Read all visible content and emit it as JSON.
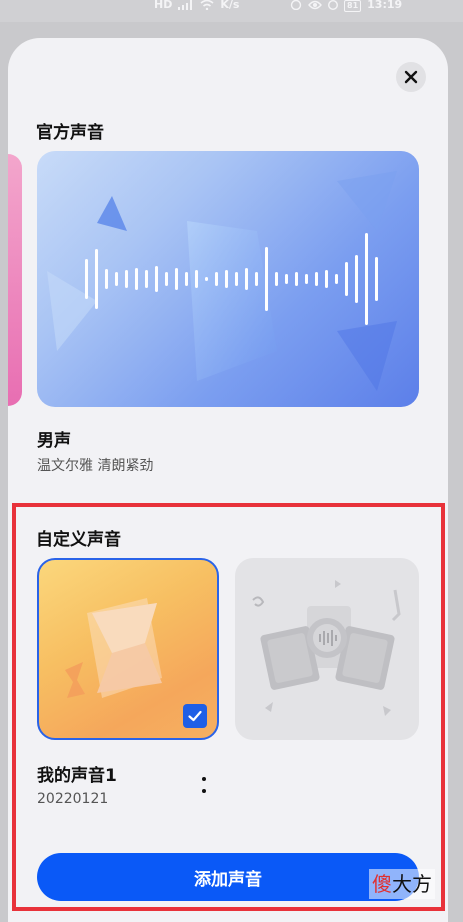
{
  "status_bar": {
    "left_icons": [
      "HD",
      "signal-icon",
      "wifi-icon",
      "K/s"
    ],
    "right_icons": [
      "nfc-icon",
      "eye-icon",
      "alarm-icon"
    ],
    "battery": "81",
    "time": "13:19"
  },
  "official": {
    "section_title": "官方声音",
    "voice_name": "男声",
    "voice_desc": "温文尔雅 清朗紧劲"
  },
  "custom": {
    "section_title": "自定义声音",
    "my_voice_name": "我的声音1",
    "my_voice_date": "20220121",
    "selected": true
  },
  "add_button_label": "添加声音",
  "watermark": {
    "first": "傻",
    "rest": "大方"
  },
  "colors": {
    "accent": "#0a59f7",
    "highlight_frame": "#e8323a",
    "selected_border": "#2a63e8"
  }
}
